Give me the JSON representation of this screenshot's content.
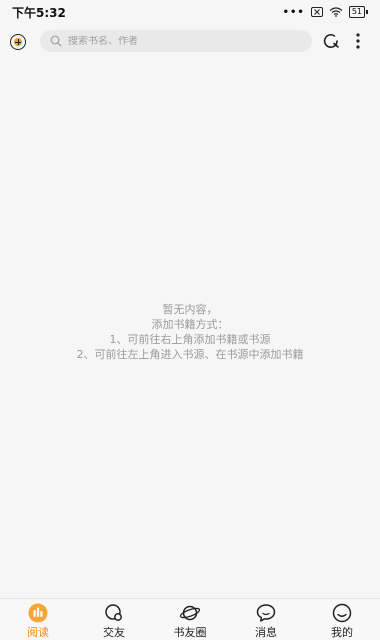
{
  "status_bar": {
    "time": "下午5:32",
    "dots": "•••",
    "battery": "51"
  },
  "top_bar": {
    "search_placeholder": "搜索书名、作者"
  },
  "empty_state": {
    "line1": "暂无内容，",
    "line2": "添加书籍方式：",
    "line3": "1、可前往右上角添加书籍或书源",
    "line4": "2、可前往左上角进入书源、在书源中添加书籍"
  },
  "bottom_nav": {
    "items": [
      {
        "label": "阅读",
        "icon": "read-icon",
        "active": true
      },
      {
        "label": "交友",
        "icon": "friends-icon",
        "active": false
      },
      {
        "label": "书友圈",
        "icon": "planet-icon",
        "active": false
      },
      {
        "label": "消息",
        "icon": "message-icon",
        "active": false
      },
      {
        "label": "我的",
        "icon": "profile-icon",
        "active": false
      }
    ]
  },
  "colors": {
    "accent": "#f08a1c",
    "background": "#f6f6f6",
    "empty_text": "#9a9a9a"
  }
}
